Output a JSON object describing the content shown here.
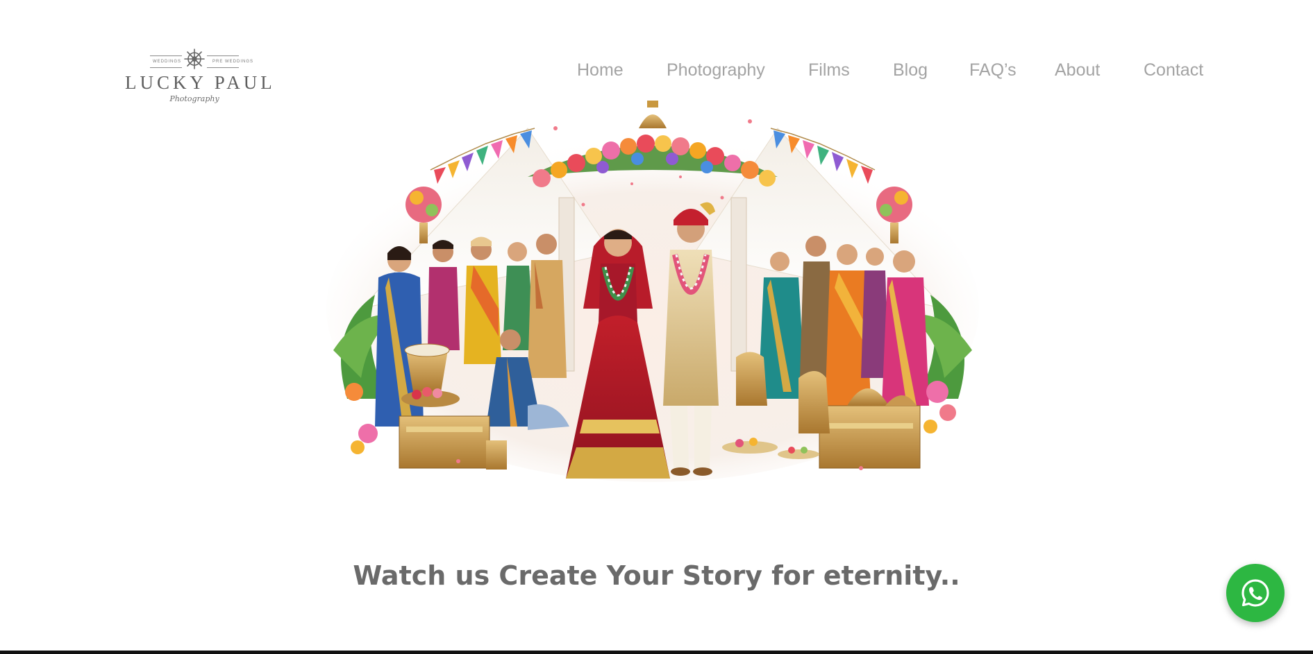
{
  "logo": {
    "small_left": "WEDDINGS",
    "small_right": "PRE WEDDINGS",
    "name": "LUCKY PAUL",
    "script": "Photography",
    "icon": "ship-wheel-icon"
  },
  "nav": {
    "items": [
      {
        "label": "Home"
      },
      {
        "label": "Photography"
      },
      {
        "label": "Films"
      },
      {
        "label": "Blog"
      },
      {
        "label": "FAQ’s"
      },
      {
        "label": "About"
      },
      {
        "label": "Contact"
      }
    ]
  },
  "hero": {
    "image": "indian-wedding-illustration"
  },
  "tagline": "Watch us Create Your Story for eternity..",
  "whatsapp": {
    "icon": "whatsapp-icon",
    "color": "#2db742"
  },
  "colors": {
    "nav_text": "#a3a3a3",
    "tagline_text": "#6a6a6a",
    "background": "#ffffff"
  }
}
